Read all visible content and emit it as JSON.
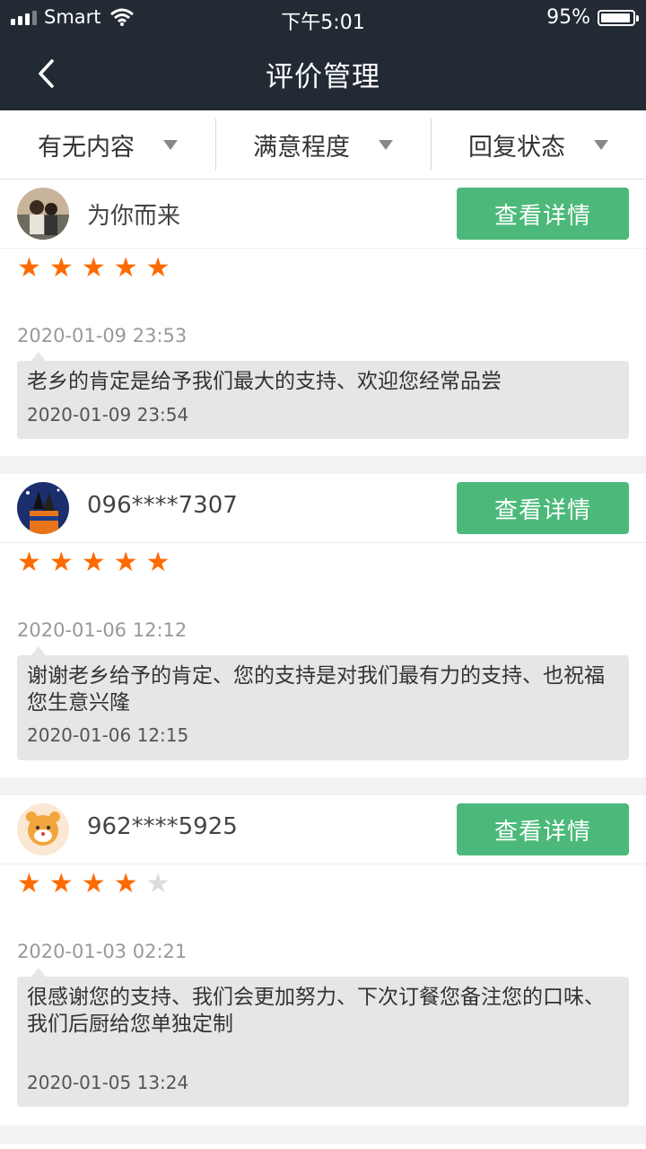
{
  "status_bar": {
    "carrier": "Smart",
    "time": "下午5:01",
    "battery": "95%",
    "battery_level": 0.95,
    "wifi_icon": "wifi-icon",
    "signal_icon": "signal-bars-icon"
  },
  "nav": {
    "title": "评价管理",
    "back_icon": "chevron-left-icon"
  },
  "filters": [
    {
      "label": "有无内容"
    },
    {
      "label": "满意程度"
    },
    {
      "label": "回复状态"
    }
  ],
  "reviews": [
    {
      "user": "为你而来",
      "button": "查看详情",
      "rating": 5,
      "review_date": "2020-01-09 23:53",
      "reply_text": "老乡的肯定是给予我们最大的支持、欢迎您经常品尝",
      "reply_date": "2020-01-09 23:54"
    },
    {
      "user": "096****7307",
      "button": "查看详情",
      "rating": 5,
      "review_date": "2020-01-06 12:12",
      "reply_text": "谢谢老乡给予的肯定、您的支持是对我们最有力的支持、也祝福您生意兴隆",
      "reply_date": "2020-01-06 12:15"
    },
    {
      "user": "962****5925",
      "button": "查看详情",
      "rating": 4,
      "review_date": "2020-01-03 02:21",
      "reply_text": "很感谢您的支持、我们会更加努力、下次订餐您备注您的口味、我们后厨给您单独定制",
      "reply_date": "2020-01-05 13:24"
    }
  ],
  "colors": {
    "header_bg": "#222a33",
    "button_green": "#4cb97a",
    "star_orange": "#ff6a00",
    "star_off": "#dcdcdc"
  }
}
